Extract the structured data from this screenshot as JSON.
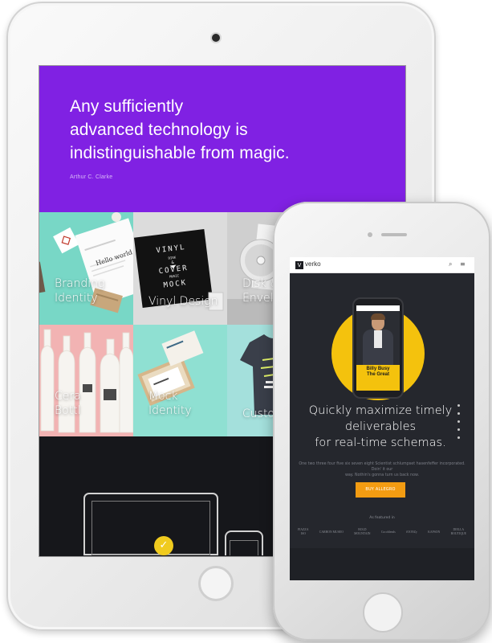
{
  "tablet": {
    "hero": {
      "quote_lines": [
        "Any sufficiently",
        "advanced technology is",
        "indistinguishable from magic."
      ],
      "author": "Arthur C. Clarke",
      "background": "#8021e3"
    },
    "tiles": [
      {
        "label_lines": [
          "Branding",
          "Identity"
        ],
        "bg": "#78d7c6"
      },
      {
        "label_lines": [
          "Vinyl Design"
        ],
        "bg": "#dcdcdc"
      },
      {
        "label_lines": [
          "Disk &",
          "Envelope"
        ],
        "bg": "#c5c5c5"
      },
      {
        "label_lines": [
          "Cera",
          "Bottl"
        ],
        "bg": "#f2b3b3"
      },
      {
        "label_lines": [
          "Mock",
          "Identity"
        ],
        "bg": "#8fe0d2"
      },
      {
        "label_lines": [
          "Custom S"
        ],
        "bg": "#a4e0dc"
      }
    ],
    "vinyl_artwork": {
      "line1": "VINYL",
      "line2": "DISK",
      "line3": "&",
      "line4": "COVER",
      "line5": "MUSIC",
      "line6": "MOCK"
    },
    "letter_text": "Hello world.",
    "check_icon": "check-icon"
  },
  "phone": {
    "nav": {
      "logo_mark": "V",
      "logo_text": "verko",
      "search_icon": "⌕",
      "menu_icon": "≡"
    },
    "mini_phone_title_lines": [
      "Billy Busy",
      "The Great"
    ],
    "headline_lines": [
      "Quickly maximize timely",
      "deliverables",
      "for real-time schemas."
    ],
    "body_lines": [
      "One two three four five six seven eight Scientist schlumpset hasenfeffer incorporated. Doin' it our",
      "way. Nothin's gonna turn us back now."
    ],
    "cta_label": "BUY ALLEGRO",
    "featured_label": "As featured in",
    "featured_logos": [
      [
        "PIAZZA",
        "ISO"
      ],
      [
        "CARBON MUSEO"
      ],
      [
        "BOLD",
        "MOUNTAIN"
      ],
      [
        "Cocoblends"
      ],
      [
        "fOONZy"
      ],
      [
        "KAPSON"
      ],
      [
        "DIELLA",
        "BOUTIQUE"
      ]
    ],
    "accent": "#f4c20d",
    "cta_color": "#f39c12"
  }
}
